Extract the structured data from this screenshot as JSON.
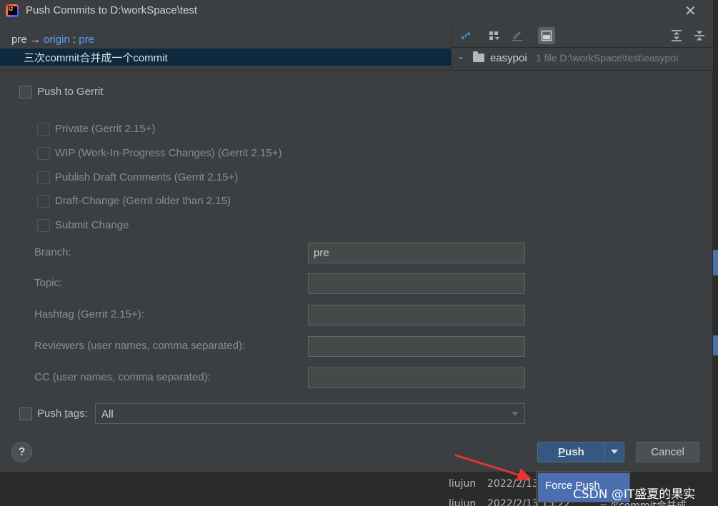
{
  "dialog": {
    "title": "Push Commits to D:\\workSpace\\test",
    "close_glyph": "✕"
  },
  "commits": {
    "branch_local": "pre",
    "arrow": "→",
    "remote": "origin",
    "separator": ":",
    "branch_remote": "pre",
    "selected_commit": "三次commit合并成一个commit"
  },
  "files": {
    "chevron": "⌄",
    "module": "easypoi",
    "meta": "1 file  D:\\workSpace\\test\\easypoi"
  },
  "gerrit": {
    "push_to_gerrit_label": "Push to Gerrit",
    "options": [
      "Private (Gerrit 2.15+)",
      "WIP (Work-In-Progress Changes) (Gerrit 2.15+)",
      "Publish Draft Comments (Gerrit 2.15+)",
      "Draft-Change (Gerrit older than 2.15)",
      "Submit Change"
    ],
    "fields": [
      {
        "label": "Branch:",
        "value": "pre"
      },
      {
        "label": "Topic:",
        "value": ""
      },
      {
        "label": "Hashtag (Gerrit 2.15+):",
        "value": ""
      },
      {
        "label": "Reviewers (user names, comma separated):",
        "value": ""
      },
      {
        "label": "CC (user names, comma separated):",
        "value": ""
      }
    ]
  },
  "push_tags": {
    "label_prefix": "Push ",
    "label_mnemonic": "t",
    "label_suffix": "ags:",
    "selected": "All"
  },
  "buttons": {
    "help": "?",
    "push_mnemonic": "P",
    "push_rest": "ush",
    "cancel": "Cancel"
  },
  "dropdown": {
    "force_push": "Force Push"
  },
  "background_log": {
    "row1_author": "liujun",
    "row1_date": "2022/2/13",
    "row2_author": "liujun",
    "row2_date": "2022/2/13 15:22",
    "row2_msg": "三次commit合并成"
  },
  "watermark": "CSDN @IT盛夏的果实",
  "colors": {
    "background": "#3c3f41",
    "selection": "#0d293e",
    "accent_blue": "#589df6",
    "push_button": "#365880",
    "menu_highlight": "#4b6eaf",
    "annotation_arrow": "#e8332f"
  }
}
